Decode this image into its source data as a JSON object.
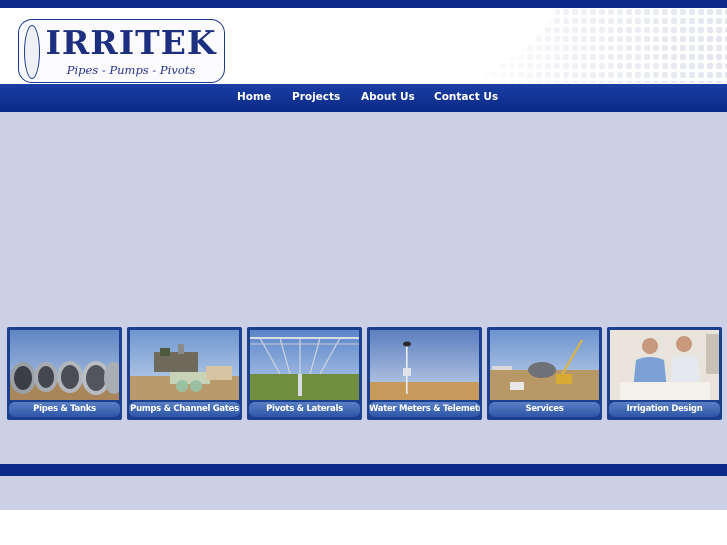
{
  "logo": {
    "title": "IRRITEK",
    "tagline": "Pipes - Pumps - Pivots"
  },
  "nav": {
    "items": [
      {
        "label": "Home"
      },
      {
        "label": "Projects"
      },
      {
        "label": "About Us"
      },
      {
        "label": "Contact Us"
      }
    ]
  },
  "categories": [
    {
      "label": "Pipes & Tanks"
    },
    {
      "label": "Pumps & Channel Gates"
    },
    {
      "label": "Pivots & Laterals"
    },
    {
      "label": "Water Meters & Telemetry"
    },
    {
      "label": "Services"
    },
    {
      "label": "Irrigation Design"
    }
  ],
  "colors": {
    "brand_blue": "#0c2a8a",
    "content_background": "#cbd0e5",
    "card_frame": "#1b3f8f"
  }
}
